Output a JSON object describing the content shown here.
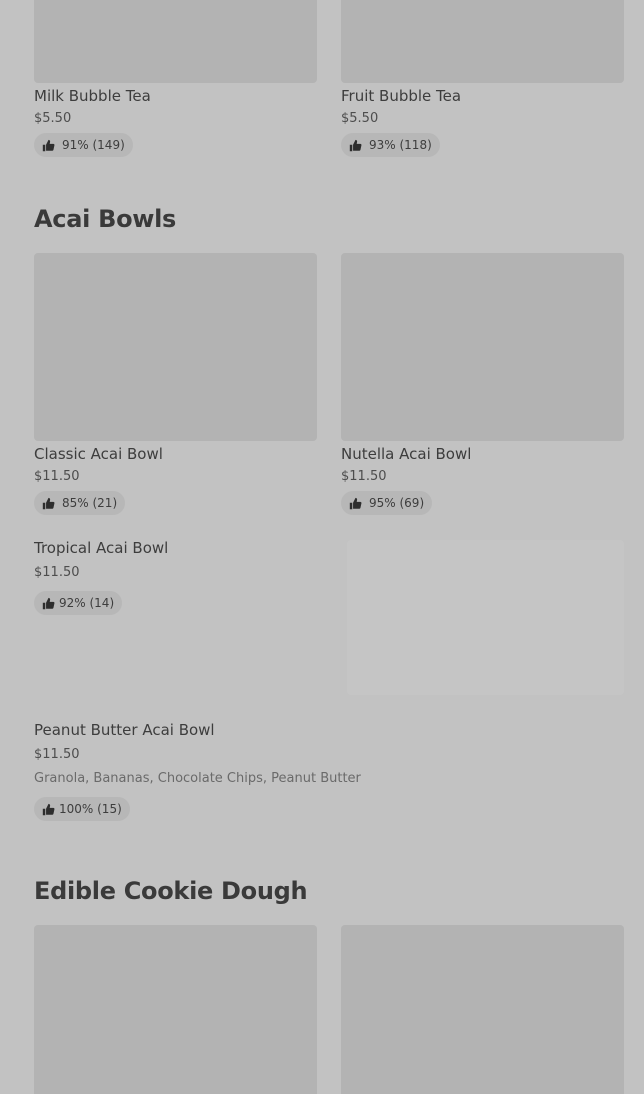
{
  "bubble_tea": {
    "items": [
      {
        "title": "Milk Bubble Tea",
        "price": "$5.50",
        "rating": "91% (149)"
      },
      {
        "title": "Fruit Bubble Tea",
        "price": "$5.50",
        "rating": "93% (118)"
      }
    ]
  },
  "acai_bowls": {
    "section_title": "Acai Bowls",
    "items": [
      {
        "title": "Classic Acai Bowl",
        "price": "$11.50",
        "rating": "85% (21)"
      },
      {
        "title": "Nutella Acai Bowl",
        "price": "$11.50",
        "rating": "95% (69)"
      },
      {
        "title": "Tropical Acai Bowl",
        "price": "$11.50",
        "rating": "92% (14)"
      },
      {
        "title": "Peanut Butter Acai Bowl",
        "price": "$11.50",
        "description": "Granola, Bananas, Chocolate Chips, Peanut Butter",
        "rating": "100% (15)"
      }
    ]
  },
  "cookie_dough": {
    "section_title": "Edible Cookie Dough"
  },
  "icons": {
    "rating": "thumbs-up-icon"
  },
  "colors": {
    "background": "#c2c2c2",
    "image_placeholder": "#b3b3b3",
    "rating_pill": "#b7b7b7"
  }
}
